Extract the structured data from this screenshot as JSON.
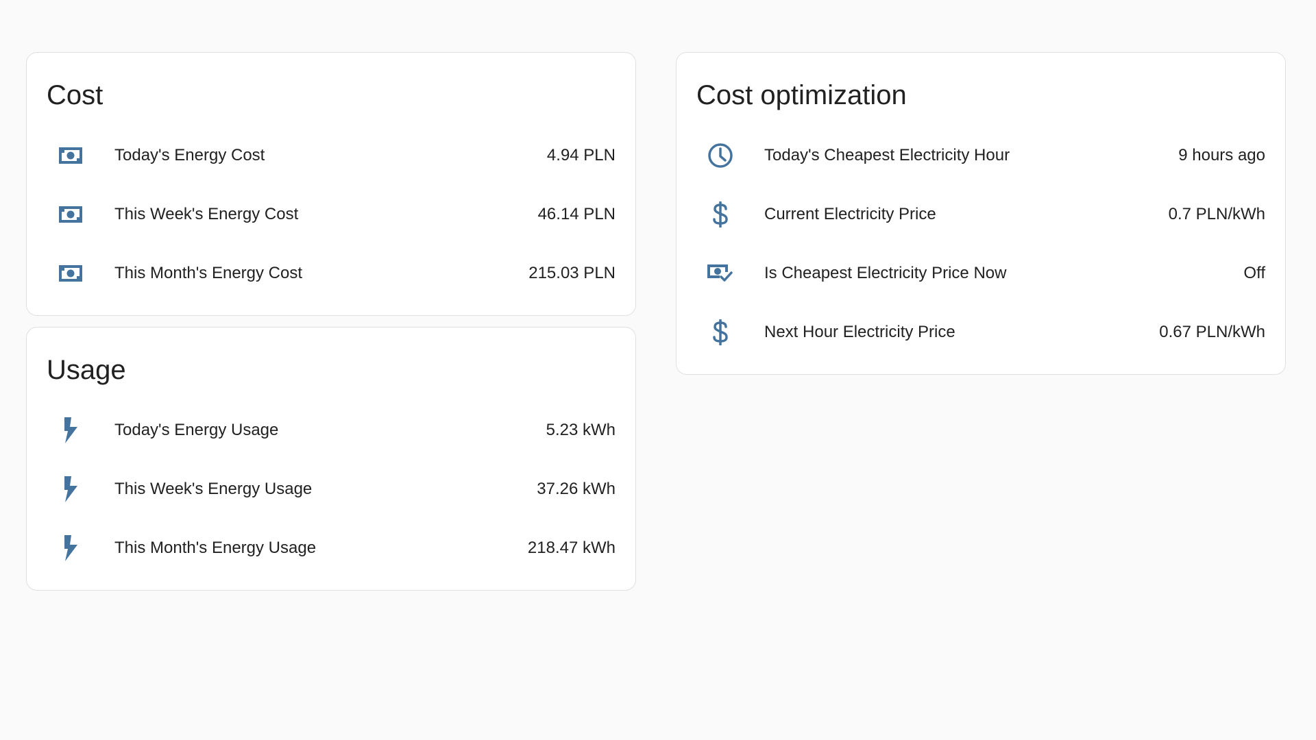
{
  "theme": {
    "icon_color": "#44739e",
    "card_border": "#e0e0e0",
    "background": "#fafafa"
  },
  "cost": {
    "title": "Cost",
    "rows": [
      {
        "icon": "cash-icon",
        "label": "Today's Energy Cost",
        "value": "4.94 PLN"
      },
      {
        "icon": "cash-icon",
        "label": "This Week's Energy Cost",
        "value": "46.14 PLN"
      },
      {
        "icon": "cash-icon",
        "label": "This Month's Energy Cost",
        "value": "215.03 PLN"
      }
    ]
  },
  "usage": {
    "title": "Usage",
    "rows": [
      {
        "icon": "lightning-bolt-icon",
        "label": "Today's Energy Usage",
        "value": "5.23 kWh"
      },
      {
        "icon": "lightning-bolt-icon",
        "label": "This Week's Energy Usage",
        "value": "37.26 kWh"
      },
      {
        "icon": "lightning-bolt-icon",
        "label": "This Month's Energy Usage",
        "value": "218.47 kWh"
      }
    ]
  },
  "optimization": {
    "title": "Cost optimization",
    "rows": [
      {
        "icon": "clock-icon",
        "label": "Today's Cheapest Electricity Hour",
        "value": "9 hours ago"
      },
      {
        "icon": "dollar-icon",
        "label": "Current Electricity Price",
        "value": "0.7 PLN/kWh"
      },
      {
        "icon": "cash-check-icon",
        "label": "Is Cheapest Electricity Price Now",
        "value": "Off"
      },
      {
        "icon": "dollar-icon",
        "label": "Next Hour Electricity Price",
        "value": "0.67 PLN/kWh"
      }
    ]
  }
}
